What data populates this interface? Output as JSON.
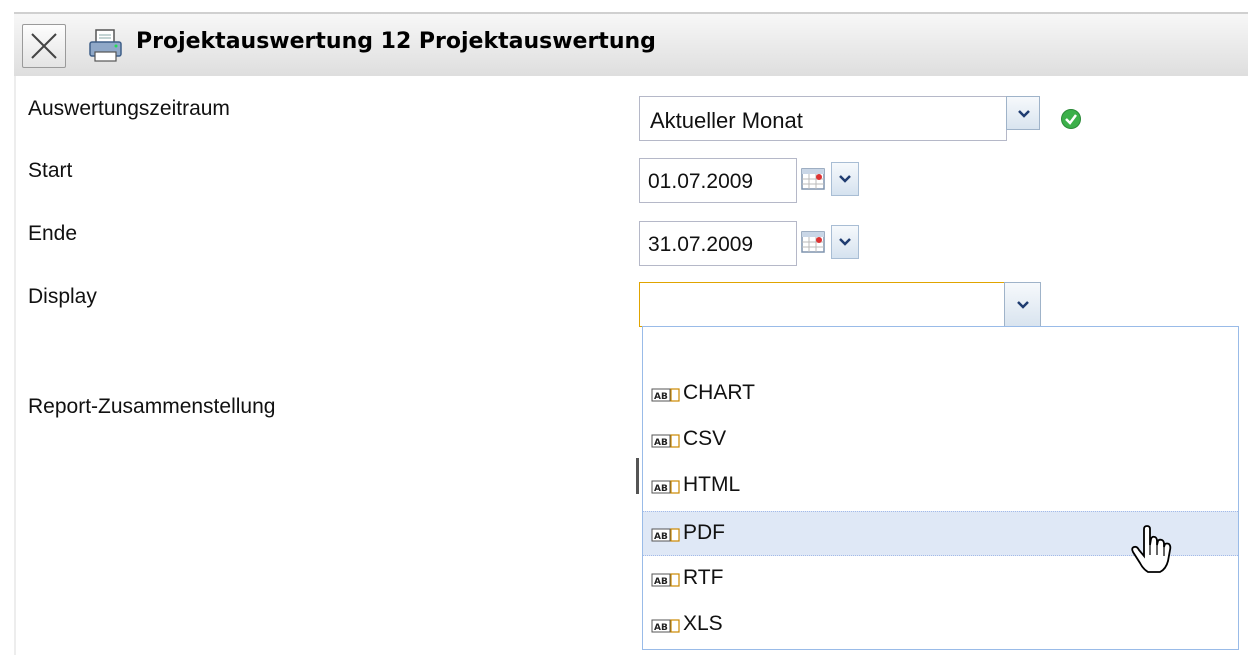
{
  "window": {
    "title": "Projektauswertung 12 Projektauswertung",
    "close_icon": "close-icon",
    "print_icon": "printer-icon"
  },
  "form": {
    "period": {
      "label": "Auswertungszeitraum",
      "value": "Aktueller Monat",
      "status_icon": "check-ok-icon"
    },
    "start": {
      "label": "Start",
      "value": "01.07.2009"
    },
    "end": {
      "label": "Ende",
      "value": "31.07.2009"
    },
    "display": {
      "label": "Display",
      "value": "",
      "options": [
        "",
        "CHART",
        "CSV",
        "HTML",
        "PDF",
        "RTF",
        "XLS"
      ],
      "highlighted": "PDF"
    },
    "report": {
      "label": "Report-Zusammenstellung"
    }
  },
  "colors": {
    "title_bar": "#e6e6e6",
    "focus_border": "#e0a400",
    "selected_row": "#dfe8f6",
    "status_ok": "#3cb04a"
  }
}
